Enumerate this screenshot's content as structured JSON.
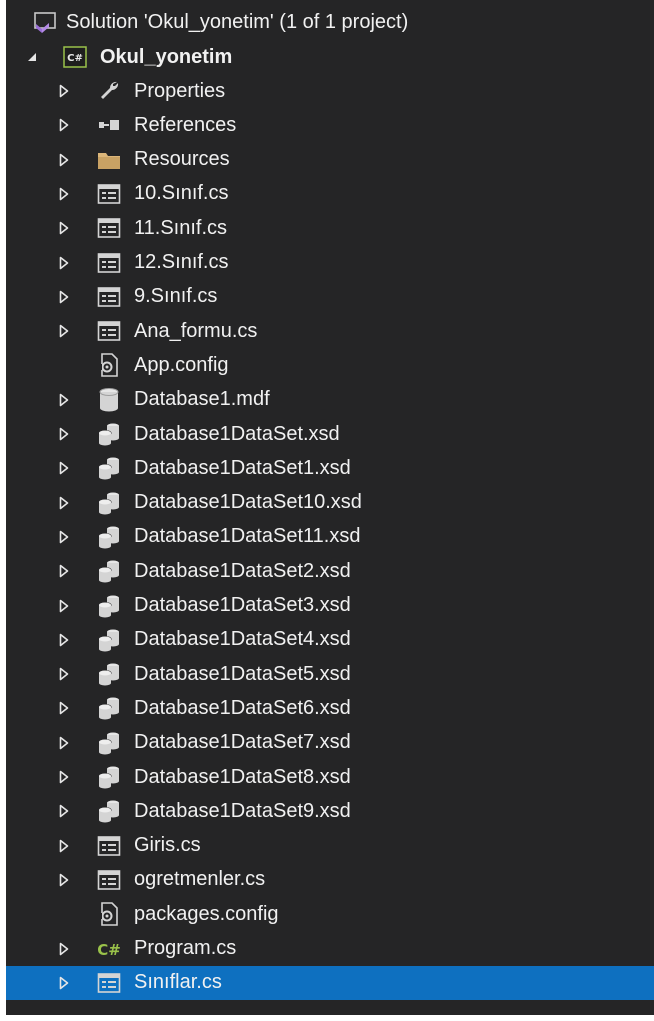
{
  "solution": {
    "label": "Solution 'Okul_yonetim' (1 of 1 project)",
    "icon": "solution-icon"
  },
  "project": {
    "label": "Okul_yonetim",
    "icon": "csharp-project-icon",
    "expanded": true
  },
  "items": [
    {
      "label": "Properties",
      "icon": "wrench-icon",
      "expandable": true
    },
    {
      "label": "References",
      "icon": "references-icon",
      "expandable": true
    },
    {
      "label": "Resources",
      "icon": "folder-icon",
      "expandable": true
    },
    {
      "label": "10.Sınıf.cs",
      "icon": "form-icon",
      "expandable": true
    },
    {
      "label": "11.Sınıf.cs",
      "icon": "form-icon",
      "expandable": true
    },
    {
      "label": "12.Sınıf.cs",
      "icon": "form-icon",
      "expandable": true
    },
    {
      "label": "9.Sınıf.cs",
      "icon": "form-icon",
      "expandable": true
    },
    {
      "label": "Ana_formu.cs",
      "icon": "form-icon",
      "expandable": true
    },
    {
      "label": "App.config",
      "icon": "config-icon",
      "expandable": false
    },
    {
      "label": "Database1.mdf",
      "icon": "database-icon",
      "expandable": true
    },
    {
      "label": "Database1DataSet.xsd",
      "icon": "dataset-icon",
      "expandable": true
    },
    {
      "label": "Database1DataSet1.xsd",
      "icon": "dataset-icon",
      "expandable": true
    },
    {
      "label": "Database1DataSet10.xsd",
      "icon": "dataset-icon",
      "expandable": true
    },
    {
      "label": "Database1DataSet11.xsd",
      "icon": "dataset-icon",
      "expandable": true
    },
    {
      "label": "Database1DataSet2.xsd",
      "icon": "dataset-icon",
      "expandable": true
    },
    {
      "label": "Database1DataSet3.xsd",
      "icon": "dataset-icon",
      "expandable": true
    },
    {
      "label": "Database1DataSet4.xsd",
      "icon": "dataset-icon",
      "expandable": true
    },
    {
      "label": "Database1DataSet5.xsd",
      "icon": "dataset-icon",
      "expandable": true
    },
    {
      "label": "Database1DataSet6.xsd",
      "icon": "dataset-icon",
      "expandable": true
    },
    {
      "label": "Database1DataSet7.xsd",
      "icon": "dataset-icon",
      "expandable": true
    },
    {
      "label": "Database1DataSet8.xsd",
      "icon": "dataset-icon",
      "expandable": true
    },
    {
      "label": "Database1DataSet9.xsd",
      "icon": "dataset-icon",
      "expandable": true
    },
    {
      "label": "Giris.cs",
      "icon": "form-icon",
      "expandable": true
    },
    {
      "label": "ogretmenler.cs",
      "icon": "form-icon",
      "expandable": true
    },
    {
      "label": "packages.config",
      "icon": "config-icon",
      "expandable": false
    },
    {
      "label": "Program.cs",
      "icon": "csharp-file-icon",
      "expandable": true
    },
    {
      "label": "Sınıflar.cs",
      "icon": "form-icon",
      "expandable": true,
      "selected": true
    }
  ],
  "colors": {
    "background": "#252526",
    "text": "#f1f1f1",
    "selection": "#0e70c0",
    "csharp_green": "#9ac24a",
    "folder": "#dcb67a",
    "solution_purple": "#9b6fd6"
  }
}
